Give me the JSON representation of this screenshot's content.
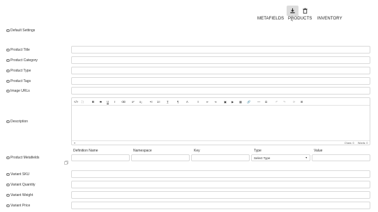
{
  "top_actions": {
    "download_icon": "download-icon",
    "delete_icon": "trash-icon"
  },
  "tabs": [
    "METAFIELDS",
    "PRODUCTS",
    "INVENTORY"
  ],
  "default_settings_label": "Default Settings",
  "fields": {
    "product_title": "Product Title",
    "product_category": "Product Category",
    "product_type": "Product Type",
    "product_tags": "Product Tags",
    "image_urls": "Image URLs",
    "description": "Description",
    "product_metafields": "Product Metafields",
    "variant_sku": "Variant SKU",
    "variant_quantity": "Variant Quantity",
    "variant_weight": "Variant Weight",
    "variant_price": "Variant Price"
  },
  "editor": {
    "toolbar": [
      "</>",
      "⛶",
      "B",
      "S",
      "U",
      "I",
      "⌫",
      "x²",
      "x₂",
      "•≡",
      "1≡",
      "T̲",
      "¶",
      "A",
      "≡",
      "⇤",
      "⇥",
      "▣",
      "▶",
      "▦",
      "🔗",
      "—",
      "Ω",
      "↶",
      "↷",
      "⟳",
      "⊞"
    ],
    "chars_label": "Chars: 0",
    "words_label": "Words: 0",
    "resize_glyph": "≡"
  },
  "metafields": {
    "headers": [
      "Definition Name",
      "Namespace",
      "Key",
      "Type",
      "Value"
    ],
    "type_select_value": "Select Type"
  }
}
